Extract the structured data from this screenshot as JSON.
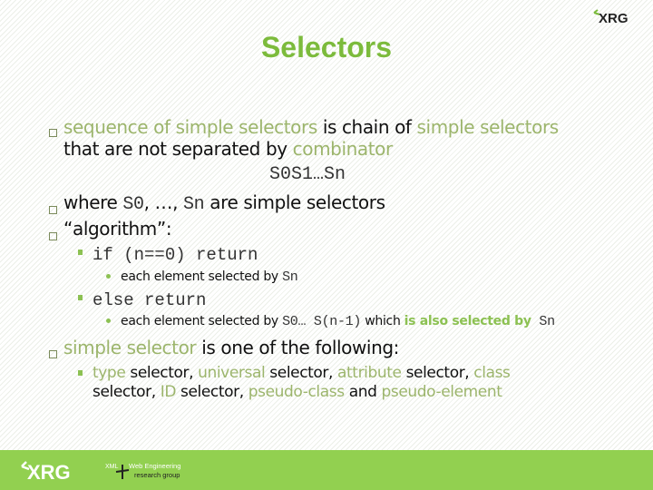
{
  "header": {
    "logo": "XRG",
    "title": "Selectors"
  },
  "bullets": [
    {
      "level": 1,
      "parts": [
        {
          "text": "sequence of simple selectors",
          "style": "green"
        },
        {
          "text": " is chain of ",
          "style": "normal"
        },
        {
          "text": "simple selectors",
          "style": "green"
        }
      ],
      "continuation": [
        {
          "text": "that are not separated by ",
          "style": "normal"
        },
        {
          "text": "combinator",
          "style": "green"
        }
      ],
      "formula": "S0S1…Sn"
    },
    {
      "level": 1,
      "parts": [
        {
          "text": "where ",
          "style": "normal"
        },
        {
          "text": "S0",
          "style": "mono"
        },
        {
          "text": ", …, ",
          "style": "normal"
        },
        {
          "text": "Sn",
          "style": "mono"
        },
        {
          "text": " are simple selectors",
          "style": "normal"
        }
      ]
    },
    {
      "level": 1,
      "parts": [
        {
          "text": "“algorithm”:",
          "style": "normal"
        }
      ]
    },
    {
      "level": 2,
      "parts": [
        {
          "text": "if (n==0) return",
          "style": "mono"
        }
      ]
    },
    {
      "level": 3,
      "parts": [
        {
          "text": "each element selected by ",
          "style": "normal"
        },
        {
          "text": "Sn",
          "style": "mono"
        }
      ]
    },
    {
      "level": 2,
      "parts": [
        {
          "text": "else return",
          "style": "mono"
        }
      ]
    },
    {
      "level": 3,
      "parts": [
        {
          "text": "each element selected by ",
          "style": "normal"
        },
        {
          "text": "S0… S(n-1)",
          "style": "mono"
        },
        {
          "text": " which ",
          "style": "normal"
        },
        {
          "text": "is also selected by",
          "style": "green-bold"
        },
        {
          "text": " Sn",
          "style": "mono"
        }
      ]
    },
    {
      "level": 1,
      "parts": [
        {
          "text": "simple selector",
          "style": "green"
        },
        {
          "text": " is one of the following:",
          "style": "normal"
        }
      ]
    },
    {
      "level": 2,
      "parts": [
        {
          "text": "type",
          "style": "green"
        },
        {
          "text": " selector, ",
          "style": "normal"
        },
        {
          "text": "universal",
          "style": "green"
        },
        {
          "text": " selector, ",
          "style": "normal"
        },
        {
          "text": "attribute",
          "style": "green"
        },
        {
          "text": " selector, ",
          "style": "normal"
        },
        {
          "text": "class",
          "style": "green"
        }
      ],
      "continuation": [
        {
          "text": "selector, ",
          "style": "normal"
        },
        {
          "text": "ID",
          "style": "green"
        },
        {
          "text": " selector, ",
          "style": "normal"
        },
        {
          "text": "pseudo-class",
          "style": "green"
        },
        {
          "text": " and ",
          "style": "normal"
        },
        {
          "text": "pseudo-element",
          "style": "green"
        }
      ]
    }
  ],
  "footer": {
    "logo": "XRG",
    "tagline_top": "XML + Web Engineering",
    "tagline_bottom": "research group",
    "color": "#92d050"
  }
}
